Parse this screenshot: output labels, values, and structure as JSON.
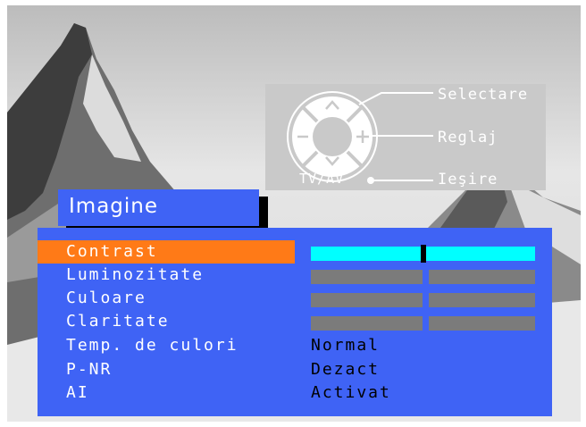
{
  "help": {
    "select_label": "Selectare",
    "adjust_label": "Reglaj",
    "exit_label": "Ieşire",
    "tvav_label": "TV/AV"
  },
  "menu": {
    "title": "Imagine",
    "items": [
      {
        "label": "Contrast",
        "type": "slider",
        "value": 0.5,
        "selected": true
      },
      {
        "label": "Luminozitate",
        "type": "slider",
        "value": 0.5,
        "selected": false
      },
      {
        "label": "Culoare",
        "type": "slider",
        "value": 0.5,
        "selected": false
      },
      {
        "label": "Claritate",
        "type": "slider",
        "value": 0.5,
        "selected": false
      },
      {
        "label": "Temp. de culori",
        "type": "text",
        "value": "Normal",
        "selected": false
      },
      {
        "label": "P-NR",
        "type": "text",
        "value": "Dezact",
        "selected": false
      },
      {
        "label": "AI",
        "type": "text",
        "value": "Activat",
        "selected": false
      }
    ]
  },
  "colors": {
    "menu_bg": "#3f63f5",
    "highlight": "#ff7a17",
    "slider_active": "#00ffff",
    "slider_inactive": "#7b7b7b"
  }
}
